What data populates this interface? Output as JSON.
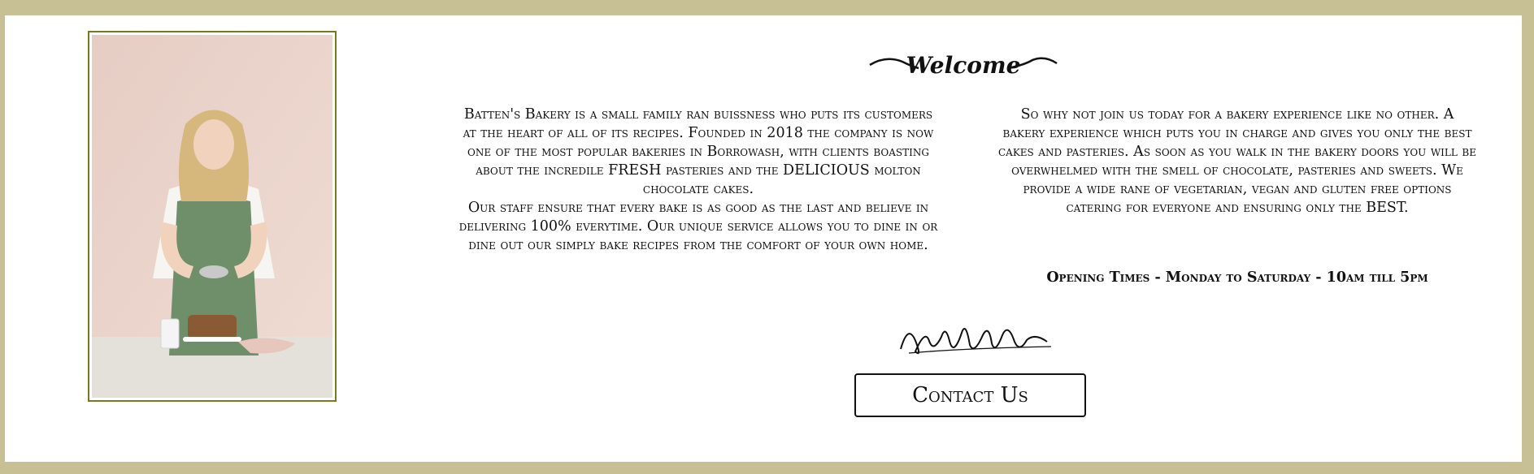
{
  "colors": {
    "page_border": "#c7c094",
    "panel_background": "#ffffff",
    "photo_frame": "#7a7a1c",
    "text": "#111111"
  },
  "photo": {
    "icon": "baker-photo"
  },
  "heading": {
    "text": "Welcome"
  },
  "intro": {
    "left_paragraph_1": "Batten's Bakery is a small family ran buissness who puts its customers at the heart of all of its recipes. Founded in 2018 the company is now one of the most popular bakeries in Borrowash, with clients boasting about the incredile FRESH pasteries and the DELICIOUS molton chocolate cakes.",
    "left_paragraph_2": "Our staff ensure that every bake is as good as the last and believe in delivering 100% everytime. Our unique service allows you to dine in or dine out our simply bake recipes from the comfort of your own home.",
    "right_paragraph": "So why not join us today for a bakery experience like no other. A bakery experience which puts you in charge and gives you only the best cakes and pasteries. As soon as you walk in the bakery doors you will be overwhelmed with the smell of chocolate, pasteries and sweets. We provide a wide rane of vegetarian, vegan and gluten free options catering for everyone and ensuring only the BEST."
  },
  "opening_times": "Opening Times - Monday to Saturday - 10am till 5pm",
  "signature": {
    "icon": "signature"
  },
  "contact_button": {
    "label": "Contact Us"
  }
}
